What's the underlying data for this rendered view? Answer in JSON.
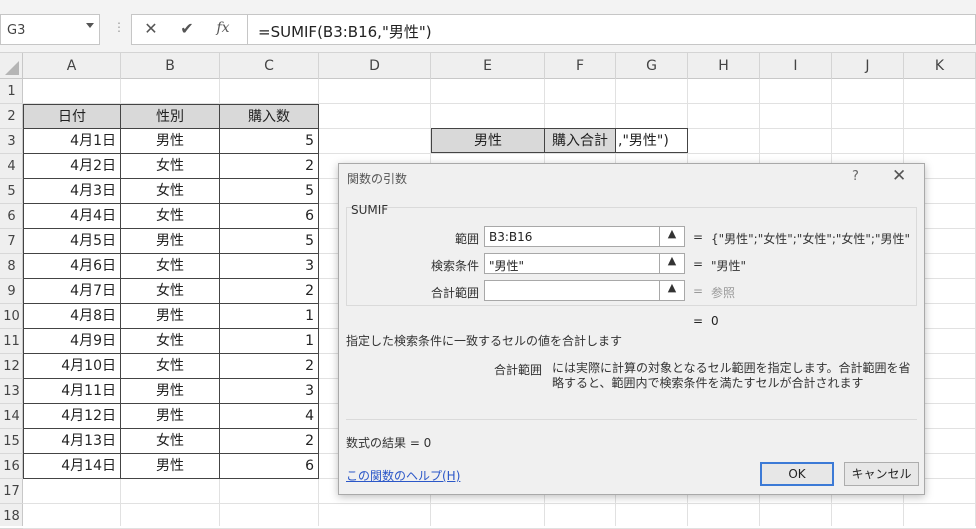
{
  "name_box": "G3",
  "formula": "=SUMIF(B3:B16,\"男性\")",
  "formula_icons": {
    "cancel": "✕",
    "enter": "✔",
    "fx": "fx"
  },
  "columns": [
    "A",
    "B",
    "C",
    "D",
    "E",
    "F",
    "G",
    "H",
    "I",
    "J",
    "K"
  ],
  "rows": [
    "1",
    "2",
    "3",
    "4",
    "5",
    "6",
    "7",
    "8",
    "9",
    "10",
    "11",
    "12",
    "13",
    "14",
    "15",
    "16",
    "17",
    "18"
  ],
  "table": {
    "headers": [
      "日付",
      "性別",
      "購入数"
    ],
    "rows": [
      [
        "4月1日",
        "男性",
        "5"
      ],
      [
        "4月2日",
        "女性",
        "2"
      ],
      [
        "4月3日",
        "女性",
        "5"
      ],
      [
        "4月4日",
        "女性",
        "6"
      ],
      [
        "4月5日",
        "男性",
        "5"
      ],
      [
        "4月6日",
        "女性",
        "3"
      ],
      [
        "4月7日",
        "女性",
        "2"
      ],
      [
        "4月8日",
        "男性",
        "1"
      ],
      [
        "4月9日",
        "女性",
        "1"
      ],
      [
        "4月10日",
        "女性",
        "2"
      ],
      [
        "4月11日",
        "男性",
        "3"
      ],
      [
        "4月12日",
        "男性",
        "4"
      ],
      [
        "4月13日",
        "女性",
        "2"
      ],
      [
        "4月14日",
        "男性",
        "6"
      ]
    ]
  },
  "summary": {
    "e3": "男性",
    "f3": "購入合計",
    "g3": ",\"男性\")"
  },
  "dialog": {
    "title": "関数の引数",
    "help_icon": "?",
    "close_icon": "✕",
    "function_name": "SUMIF",
    "args": [
      {
        "label": "範囲",
        "value": "B3:B16",
        "result": "{\"男性\";\"女性\";\"女性\";\"女性\";\"男性\""
      },
      {
        "label": "検索条件",
        "value": "\"男性\"",
        "result": "\"男性\""
      },
      {
        "label": "合計範囲",
        "value": "",
        "result": "参照"
      }
    ],
    "eq": "=",
    "result_value": "0",
    "description": "指定した検索条件に一致するセルの値を合計します",
    "arg_help_name": "合計範囲",
    "arg_help_text": "には実際に計算の対象となるセル範囲を指定します。合計範囲を省略すると、範囲内で検索条件を満たすセルが合計されます",
    "formula_result": "数式の結果 =   0",
    "help_link": "この関数のヘルプ(H)",
    "ok_label": "OK",
    "cancel_label": "キャンセル"
  }
}
